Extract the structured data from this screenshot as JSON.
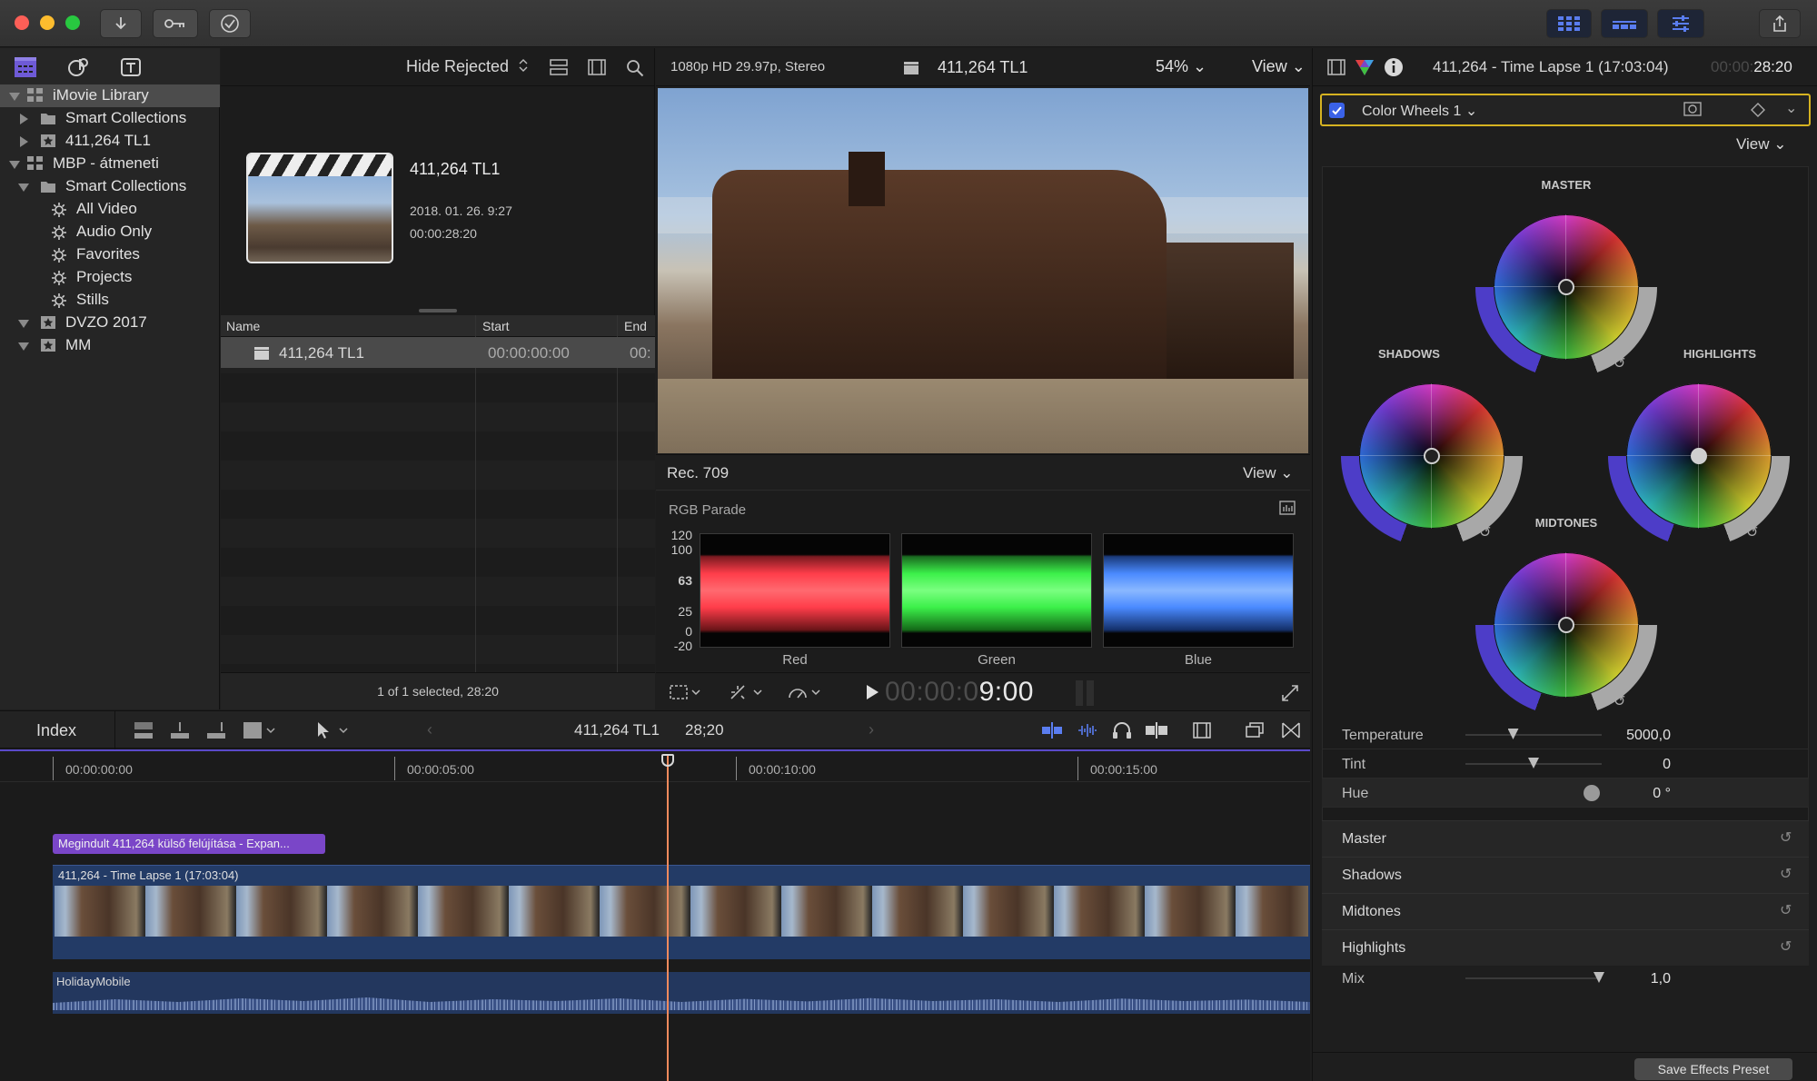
{
  "titlebar": {
    "icons": [
      "download-icon",
      "key-icon",
      "checkmark-circle-icon",
      "browser-layout-icon",
      "timeline-layout-icon",
      "inspector-layout-icon",
      "share-icon"
    ]
  },
  "library": {
    "toolbar_icons": [
      "libraries-icon",
      "photos-audio-icon",
      "titles-generators-icon"
    ],
    "items": [
      {
        "label": "iMovie Library",
        "icon": "library-icon",
        "level": 0,
        "expanded": true,
        "selected": true
      },
      {
        "label": "Smart Collections",
        "icon": "folder-icon",
        "level": 1,
        "expanded": false
      },
      {
        "label": "411,264 TL1",
        "icon": "event-star-icon",
        "level": 1,
        "expanded": false
      },
      {
        "label": "MBP - átmeneti",
        "icon": "library-icon",
        "level": 0,
        "expanded": true
      },
      {
        "label": "Smart Collections",
        "icon": "folder-icon",
        "level": 1,
        "expanded": true
      },
      {
        "label": "All Video",
        "icon": "gear-icon",
        "level": 2
      },
      {
        "label": "Audio Only",
        "icon": "gear-icon",
        "level": 2
      },
      {
        "label": "Favorites",
        "icon": "gear-icon",
        "level": 2
      },
      {
        "label": "Projects",
        "icon": "gear-icon",
        "level": 2
      },
      {
        "label": "Stills",
        "icon": "gear-icon",
        "level": 2
      },
      {
        "label": "DVZO 2017",
        "icon": "event-star-icon",
        "level": 1,
        "expanded": true
      },
      {
        "label": "MM",
        "icon": "event-star-icon",
        "level": 1,
        "expanded": true
      }
    ]
  },
  "browser": {
    "filter_label": "Hide Rejected",
    "clip": {
      "title": "411,264 TL1",
      "date": "2018. 01. 26. 9:27",
      "duration": "00:00:28:20"
    },
    "columns": [
      "Name",
      "Start",
      "End"
    ],
    "rows": [
      {
        "name": "411,264 TL1",
        "start": "00:00:00:00",
        "end": "00:"
      }
    ],
    "status": "1 of 1 selected, 28:20"
  },
  "viewer": {
    "format": "1080p HD 29.97p, Stereo",
    "clip_name": "411,264 TL1",
    "zoom": "54%",
    "view_label": "View",
    "scope_colorspace": "Rec. 709",
    "scope_view_label": "View",
    "scope_name": "RGB Parade",
    "scale_labels": [
      "120",
      "100",
      "63",
      "25",
      "0",
      "-20"
    ],
    "channels": [
      "Red",
      "Green",
      "Blue"
    ],
    "timecode_dim": "00:00:0",
    "timecode_bright": "9:00"
  },
  "timeline": {
    "index_label": "Index",
    "project_name": "411,264 TL1",
    "project_duration": "28;20",
    "ruler": [
      "00:00:00:00",
      "00:00:05:00",
      "00:00:10:00",
      "00:00:15:00"
    ],
    "title_clip": "Megindult 411,264 külső felújítása - Expan...",
    "video_clip": "411,264 - Time Lapse 1 (17:03:04)",
    "audio_clip": "HolidayMobile"
  },
  "inspector": {
    "header_title": "411,264 - Time Lapse 1 (17:03:04)",
    "header_tc_dim": "00:00:",
    "header_tc": "28:20",
    "effect_name": "Color Wheels 1",
    "view_label": "View",
    "wheels": [
      "MASTER",
      "SHADOWS",
      "HIGHLIGHTS",
      "MIDTONES"
    ],
    "params": [
      {
        "label": "Temperature",
        "value": "5000,0",
        "slider": 0.35
      },
      {
        "label": "Tint",
        "value": "0",
        "slider": 0.5
      },
      {
        "label": "Hue",
        "value": "0 °",
        "slider": null
      }
    ],
    "sections": [
      "Master",
      "Shadows",
      "Midtones",
      "Highlights"
    ],
    "mix": {
      "label": "Mix",
      "value": "1,0",
      "slider": 0.98
    },
    "save_preset": "Save Effects Preset"
  },
  "colors": {
    "accent_purple": "#6e5ad6",
    "playhead": "#f08a5d",
    "effect_border": "#d6b321",
    "clip_blue": "#233b66",
    "title_purple": "#7a46c8"
  }
}
